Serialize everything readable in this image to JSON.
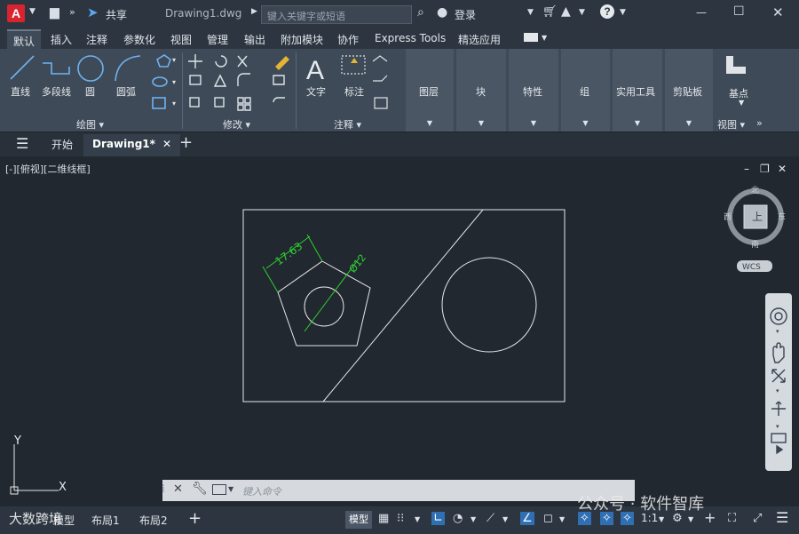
{
  "app": {
    "logo_letter": "A",
    "share_label": "共享",
    "file_title": "Drawing1.dwg",
    "search_placeholder": "键入关键字或短语",
    "login_label": "登录"
  },
  "ribbon_tabs": [
    "默认",
    "插入",
    "注释",
    "参数化",
    "视图",
    "管理",
    "输出",
    "附加模块",
    "协作",
    "Express Tools",
    "精选应用"
  ],
  "ribbon": {
    "draw": {
      "line": "直线",
      "polyline": "多段线",
      "circle": "圆",
      "arc": "圆弧",
      "panel": "绘图 ▾"
    },
    "modify": {
      "panel": "修改 ▾"
    },
    "annotation": {
      "text": "文字",
      "dimension": "标注",
      "panel": "注释 ▾"
    },
    "layers": "图层",
    "block": "块",
    "properties": "特性",
    "groups": "组",
    "utilities": "实用工具",
    "clipboard": "剪贴板",
    "view": {
      "base": "基点",
      "panel": "视图 ▾"
    }
  },
  "doc_tabs": {
    "start": "开始",
    "drawing": "Drawing1*"
  },
  "viewport": {
    "label": "[-][俯视][二维线框]"
  },
  "viewcube": {
    "north": "北",
    "south": "南",
    "east": "东",
    "west": "西",
    "top": "上",
    "wcs": "WCS"
  },
  "drawing": {
    "dim_linear": "17.63",
    "dim_diameter": "Ø12",
    "ucs_x": "X",
    "ucs_y": "Y"
  },
  "command": {
    "placeholder": "键入命令"
  },
  "status": {
    "tab_model": "模型",
    "tab_layout1": "布局1",
    "tab_layout2": "布局2",
    "model_btn": "模型",
    "scale": "1:1"
  },
  "watermarks": {
    "right": "公众号 · 软件智库",
    "left": "大数跨境"
  },
  "colors": {
    "accent_blue": "#2f6fb3",
    "dim_green": "#2fd12f",
    "logo_red": "#d8242e"
  }
}
